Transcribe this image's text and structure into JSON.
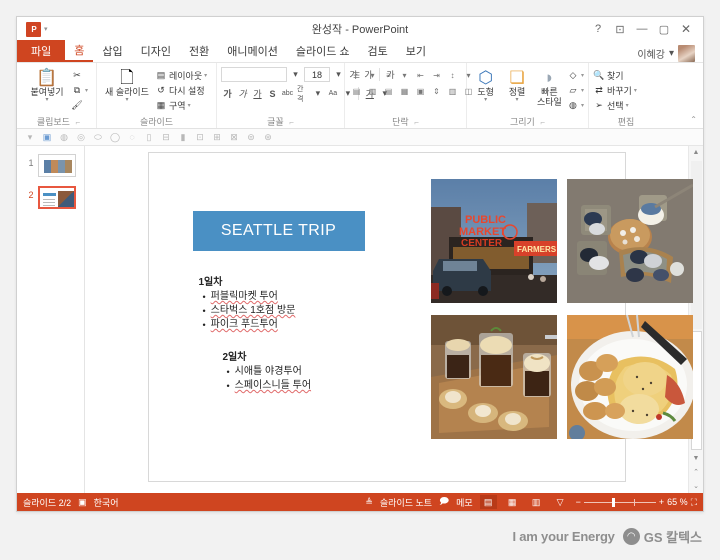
{
  "window": {
    "title": "완성작 - PowerPoint",
    "app_icon": "powerpoint-icon",
    "help_label": "?",
    "ribbon_display_label": "⊡",
    "minimize_label": "—",
    "maximize_label": "▢",
    "close_label": "✕"
  },
  "tabs": [
    {
      "label": "파일",
      "type": "file"
    },
    {
      "label": "홈",
      "type": "active"
    },
    {
      "label": "삽입",
      "type": "normal"
    },
    {
      "label": "디자인",
      "type": "normal"
    },
    {
      "label": "전환",
      "type": "normal"
    },
    {
      "label": "애니메이션",
      "type": "normal"
    },
    {
      "label": "슬라이드 쇼",
      "type": "normal"
    },
    {
      "label": "검토",
      "type": "normal"
    },
    {
      "label": "보기",
      "type": "normal"
    }
  ],
  "account": {
    "user_name": "이혜강",
    "caret": "▾"
  },
  "ribbon": {
    "clipboard": {
      "group_label": "클립보드",
      "paste_label": "붙여넣기",
      "paste_icon": "clipboard-icon",
      "cut_icon": "scissors-icon",
      "copy_icon": "copy-icon",
      "format_painter_icon": "format-painter-icon",
      "dialog_launcher": "⌐"
    },
    "slides": {
      "group_label": "슬라이드",
      "new_slide_label": "새 슬라이드",
      "new_slide_icon": "new-slide-icon",
      "layout_label": "레이아웃",
      "layout_icon": "layout-icon",
      "reset_label": "다시 설정",
      "reset_icon": "reset-icon",
      "section_label": "구역",
      "section_icon": "section-icon"
    },
    "font": {
      "group_label": "글꼴",
      "font_name_value": "",
      "font_size_value": "18",
      "grow_font": "가",
      "shrink_font": "가",
      "clear_format": "가",
      "bold": "가",
      "italic": "가",
      "underline": "가",
      "shadow": "S",
      "strikethrough": "abc",
      "char_spacing": "간격",
      "change_case": "Aa",
      "font_color": "가",
      "dialog_launcher": "⌐"
    },
    "paragraph": {
      "group_label": "단락",
      "bullets_icon": "bullet-list-icon",
      "numbering_icon": "numbered-list-icon",
      "decrease_indent_icon": "decrease-indent-icon",
      "increase_indent_icon": "increase-indent-icon",
      "line_spacing_icon": "line-spacing-icon",
      "text_direction_icon": "text-direction-icon",
      "align_left_icon": "align-left-icon",
      "align_center_icon": "align-center-icon",
      "align_right_icon": "align-right-icon",
      "justify_icon": "justify-icon",
      "columns_icon": "columns-icon",
      "align_text_icon": "align-text-icon",
      "smartart_icon": "smartart-icon",
      "dialog_launcher": "⌐"
    },
    "drawing": {
      "group_label": "그리기",
      "shapes_label": "도형",
      "shapes_icon": "shapes-icon",
      "arrange_label": "정렬",
      "arrange_icon": "arrange-icon",
      "quick_styles_label_line1": "빠른",
      "quick_styles_label_line2": "스타일",
      "quick_styles_icon": "quick-styles-icon",
      "shape_fill_icon": "shape-fill-icon",
      "shape_outline_icon": "shape-outline-icon",
      "shape_effects_icon": "shape-effects-icon",
      "dialog_launcher": "⌐"
    },
    "editing": {
      "group_label": "편집",
      "find_label": "찾기",
      "find_icon": "find-icon",
      "replace_label": "바꾸기",
      "replace_icon": "replace-icon",
      "select_label": "선택",
      "select_icon": "select-icon"
    },
    "collapse_ribbon_icon": "chevron-up-icon"
  },
  "thumbnails": [
    {
      "number": "1",
      "selected": false
    },
    {
      "number": "2",
      "selected": true
    }
  ],
  "slide": {
    "title": "SEATTLE TRIP",
    "title_bg": "#4a90c4",
    "sections": [
      {
        "heading": "1일차",
        "items": [
          {
            "text": "퍼블릭마켓 투어",
            "spellcheck": true
          },
          {
            "text": "스타벅스 1호점 방문",
            "spellcheck": true
          },
          {
            "text": "파이크 푸드투어",
            "spellcheck": true
          }
        ]
      },
      {
        "heading": "2일차",
        "items": [
          {
            "text": "시애틀 야경투어",
            "spellcheck": false
          },
          {
            "text": "스페이스니들 투어",
            "spellcheck": true
          }
        ]
      }
    ],
    "photos": [
      {
        "name": "photo-pike-place-market",
        "caption": "PUBLIC MARKET CENTER / FARMERS"
      },
      {
        "name": "photo-cafe-lounge",
        "caption": "overhead cafe seating"
      },
      {
        "name": "photo-coffee-drinks",
        "caption": "iced coffee flight with desserts"
      },
      {
        "name": "photo-eggs-benedict",
        "caption": "eggs benedict with potatoes"
      }
    ]
  },
  "scrollbar": {
    "up_arrow": "▲",
    "down_arrow": "▼",
    "prev_slide": "⌃",
    "next_slide": "⌄"
  },
  "statusbar": {
    "slide_indicator": "슬라이드 2/2",
    "language_icon": "language-icon",
    "language": "한국어",
    "notes_icon": "notes-icon",
    "notes_label": "슬라이드 노트",
    "comments_icon": "comments-icon",
    "comments_label": "메모",
    "view_normal_icon": "normal-view-icon",
    "view_sorter_icon": "slide-sorter-icon",
    "view_reading_icon": "reading-view-icon",
    "view_slideshow_icon": "slideshow-icon",
    "zoom_out": "−",
    "zoom_in": "+",
    "zoom_level": "65 %",
    "fit_icon": "fit-to-window-icon"
  },
  "footer": {
    "tagline": "I am your Energy",
    "logo_mark": "gs-caltex-logo-icon",
    "brand_name": "GS 칼텍스"
  }
}
